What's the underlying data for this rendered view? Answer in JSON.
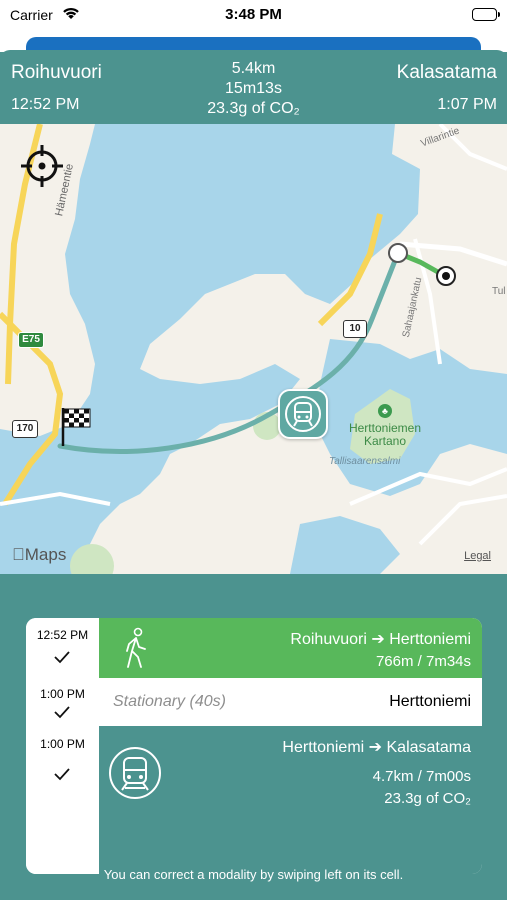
{
  "status_bar": {
    "carrier": "Carrier",
    "time": "3:48 PM"
  },
  "trip": {
    "from": "Roihuvuori",
    "to": "Kalasatama",
    "departure": "12:52 PM",
    "arrival": "1:07 PM",
    "distance": "5.4km",
    "duration": "15m13s",
    "co2": "23.3g of CO₂"
  },
  "map": {
    "labels": {
      "hameentie": "Hämeentie",
      "villarintie": "Villarintie",
      "sahaajankatu": "Sahaajankatu",
      "herttoniemen_kartano": "Herttoniemen\nKartano",
      "tallisaarensalmi": "Tallisaarensalmi",
      "tul": "Tul",
      "e75": "E75",
      "r170": "170",
      "r10": "10"
    },
    "attribution": "Maps",
    "legal": "Legal",
    "colors": {
      "water": "#a8d5ea",
      "land": "#f4f1ea",
      "route": "#6bb0aa",
      "walk": "#58b85b",
      "road": "#f7d559"
    }
  },
  "legs": [
    {
      "time": "12:52 PM",
      "mode_icon": "walking-icon",
      "title": "Roihuvuori ➔ Herttoniemi",
      "detail": "766m / 7m34s"
    },
    {
      "time": "1:00 PM",
      "stationary_label": "Stationary (40s)",
      "place": "Herttoniemi"
    },
    {
      "time": "1:00 PM",
      "mode_icon": "metro-icon",
      "title": "Herttoniemi ➔ Kalasatama",
      "detail": "4.7km / 7m00s",
      "co2": "23.3g of CO₂"
    }
  ],
  "hint": "You can correct a modality by swiping left on its cell."
}
